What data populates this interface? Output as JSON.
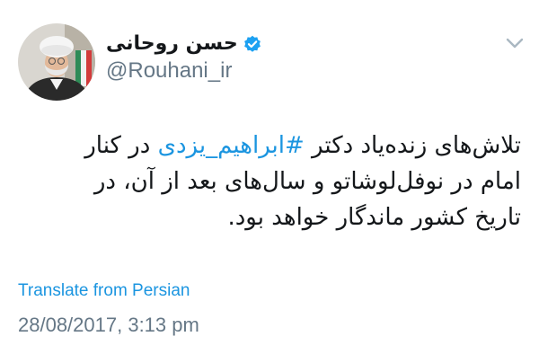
{
  "user": {
    "display_name": "حسن روحانی",
    "handle": "@Rouhani_ir",
    "verified_icon": "verified-badge-icon"
  },
  "menu": {
    "icon": "chevron-down-icon"
  },
  "tweet": {
    "line1_before": "تلاش‌های زنده‌یاد دکتر ",
    "hashtag": "#ابراهیم_یزدی",
    "line1_after": " در کنار",
    "line2": "امام در نوفل‌لوشاتو و سال‌های بعد از آن، در",
    "line3": "تاریخ کشور ماندگار خواهد بود."
  },
  "translate_label": "Translate from Persian",
  "timestamp": "28/08/2017, 3:13 pm",
  "colors": {
    "link": "#1b95e0",
    "text": "#14171a",
    "muted": "#657786",
    "verified": "#1da1f2"
  }
}
